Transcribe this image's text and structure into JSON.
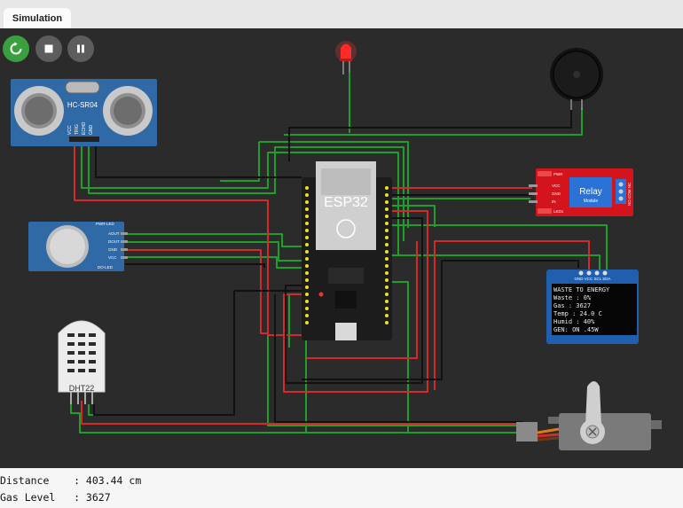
{
  "tab": {
    "label": "Simulation"
  },
  "controls": {
    "restart_icon": "restart-icon",
    "stop_icon": "stop-icon",
    "pause_icon": "pause-icon"
  },
  "components": {
    "ultrasonic": {
      "model": "HC-SR04",
      "pins": [
        "VCC",
        "TRIG",
        "ECHO",
        "GND"
      ]
    },
    "mcu": {
      "label": "ESP32"
    },
    "relay": {
      "title": "Relay",
      "subtitle": "Module",
      "pins": [
        "VCC",
        "GND",
        "IN"
      ],
      "led_pwr": "PWR",
      "led_1": "LED1",
      "side": "NO COM NC"
    },
    "gas_sensor": {
      "pins": [
        "AOUT",
        "DOUT",
        "GND",
        "VCC"
      ],
      "led_labels": [
        "PWR-LED",
        "DO-LED"
      ]
    },
    "dht": {
      "label": "DHT22"
    },
    "oled": {
      "header_pins": "GND VCC SCL SDA",
      "lines": [
        "WASTE TO ENERGY",
        "Waste : 0%",
        "Gas   : 3627",
        "Temp  : 24.0 C",
        "Humid : 40%",
        "GEN: ON  .45W"
      ]
    }
  },
  "colors": {
    "wire_green": "#1e9e2a",
    "wire_red": "#d42a2a",
    "wire_black": "#111111",
    "restart_button": "#3a9f3e"
  },
  "console": {
    "lines": [
      "Distance    : 403.44 cm",
      "Gas Level   : 3627"
    ]
  }
}
